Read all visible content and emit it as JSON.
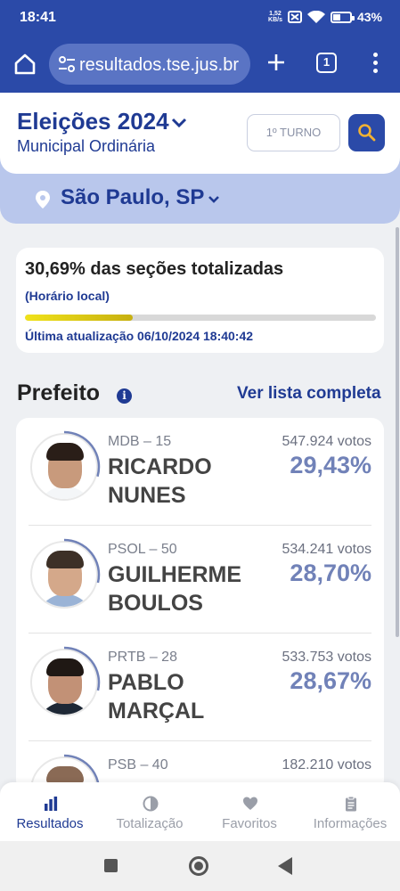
{
  "status_bar": {
    "time": "18:41",
    "net_speed_value": "1,52",
    "net_speed_unit": "KB/s",
    "battery": "43%"
  },
  "browser": {
    "url": "resultados.tse.jus.br",
    "tab_count": "1"
  },
  "header": {
    "title": "Eleições 2024",
    "subtitle": "Municipal Ordinária",
    "turno_label": "1º TURNO",
    "location": "São Paulo, SP"
  },
  "progress": {
    "title": "30,69% das seções totalizadas",
    "time_note": "(Horário local)",
    "percent": 30.69,
    "last_update": "Última atualização 06/10/2024 18:40:42"
  },
  "section": {
    "title": "Prefeito",
    "see_all": "Ver lista completa"
  },
  "candidates": [
    {
      "party": "MDB – 15",
      "name_line1": "RICARDO",
      "name_line2": "NUNES",
      "votes": "547.924 votos",
      "percent": "29,43%",
      "pct_value": 29.43
    },
    {
      "party": "PSOL – 50",
      "name_line1": "GUILHERME",
      "name_line2": "BOULOS",
      "votes": "534.241 votos",
      "percent": "28,70%",
      "pct_value": 28.7
    },
    {
      "party": "PRTB – 28",
      "name_line1": "PABLO",
      "name_line2": "MARÇAL",
      "votes": "533.753 votos",
      "percent": "28,67%",
      "pct_value": 28.67
    },
    {
      "party": "PSB – 40",
      "name_line1": "",
      "name_line2": "",
      "votes": "182.210 votos",
      "percent": "",
      "pct_value": null
    }
  ],
  "bottom_nav": {
    "items": [
      {
        "label": "Resultados",
        "icon": "bar-chart-icon",
        "active": true
      },
      {
        "label": "Totalização",
        "icon": "pie-chart-icon",
        "active": false
      },
      {
        "label": "Favoritos",
        "icon": "heart-icon",
        "active": false
      },
      {
        "label": "Informações",
        "icon": "clipboard-icon",
        "active": false
      }
    ]
  },
  "colors": {
    "primary": "#2b4aa8",
    "text_primary": "#1f3a93",
    "accent_progress": "#e6d41a",
    "percent_text": "#7182b8"
  }
}
